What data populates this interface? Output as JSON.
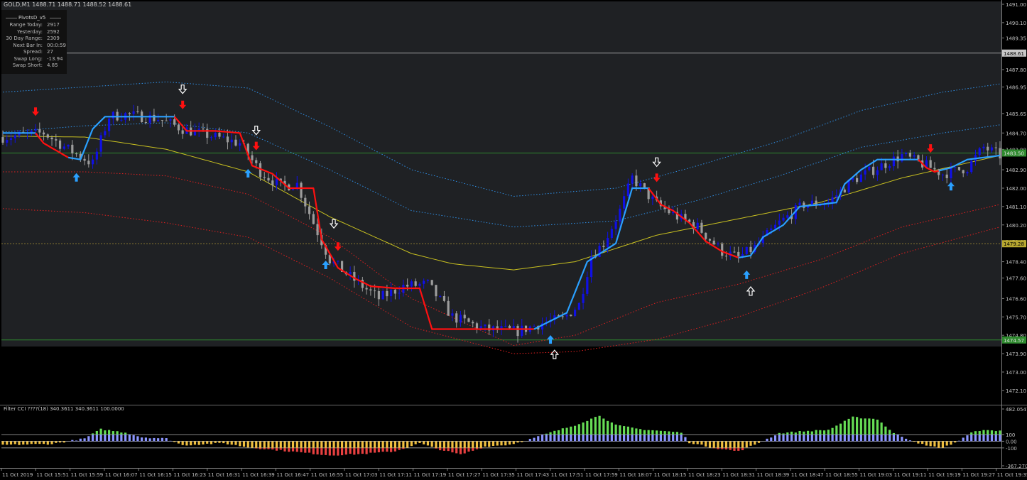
{
  "symbol": {
    "header": "GOLD,M1",
    "ohlc": "1488.71 1488.71 1488.52 1488.61"
  },
  "info_panel": {
    "title": "PivotsD_v5",
    "rows": [
      {
        "label": "Range  Today:",
        "value": "2917"
      },
      {
        "label": "Yesterday:",
        "value": "2592"
      },
      {
        "label": "30 Day Range:",
        "value": "2309"
      },
      {
        "label": "Next Bar In:",
        "value": "00:0:59"
      },
      {
        "label": "Spread:",
        "value": "27"
      },
      {
        "label": "Swap  Long:",
        "value": "-13.94"
      },
      {
        "label": "Swap  Short:",
        "value": "4.85"
      }
    ]
  },
  "indicator_label": "Filter CCI ????(18)  340.3611 340.3611 100.0000",
  "colors": {
    "background": "#000000",
    "price_area": "#1f2124",
    "bull_candle": "#1010e6",
    "bear_candle": "#9c9c9c",
    "trail_bull": "#2aa0ff",
    "trail_bear": "#ff1010",
    "ma": "#c8c020",
    "band_blue": "#2f8fe6",
    "band_red": "#e02020",
    "hist_green": "#66dd55",
    "hist_blue": "#8c96ff",
    "hist_yellow": "#f0c040",
    "hist_red": "#e84040",
    "level_green": "#2e8a2e",
    "axis_text": "#c0c0c0"
  },
  "chart_data": [
    {
      "type": "candlestick",
      "title": "GOLD,M1",
      "ylim": [
        1471.4,
        1491.0
      ],
      "y_ticks": [
        "1491.00",
        "1490.10",
        "1489.35",
        "1487.80",
        "1486.95",
        "1485.65",
        "1484.70",
        "1483.90",
        "1482.90",
        "1482.00",
        "1481.10",
        "1480.20",
        "1479.40",
        "1478.40",
        "1477.60",
        "1476.60",
        "1475.70",
        "1474.80",
        "1473.90",
        "1473.00",
        "1472.10"
      ],
      "price_labels": [
        {
          "text": "1488.61",
          "value": 1488.61,
          "kind": "bid"
        },
        {
          "text": "1483.50",
          "value": 1483.72,
          "kind": "green"
        },
        {
          "text": "1479.28",
          "value": 1479.28,
          "kind": "pivot"
        },
        {
          "text": "1474.57",
          "value": 1474.57,
          "kind": "green"
        }
      ],
      "x_labels": [
        "11 Oct 2019",
        "11 Oct 15:51",
        "11 Oct 15:59",
        "11 Oct 16:07",
        "11 Oct 16:15",
        "11 Oct 16:23",
        "11 Oct 16:31",
        "11 Oct 16:39",
        "11 Oct 16:47",
        "11 Oct 16:55",
        "11 Oct 17:03",
        "11 Oct 17:11",
        "11 Oct 17:19",
        "11 Oct 17:27",
        "11 Oct 17:35",
        "11 Oct 17:43",
        "11 Oct 17:51",
        "11 Oct 17:59",
        "11 Oct 18:07",
        "11 Oct 18:15",
        "11 Oct 18:23",
        "11 Oct 18:31",
        "11 Oct 18:39",
        "11 Oct 18:47",
        "11 Oct 18:55",
        "11 Oct 19:03",
        "11 Oct 19:11",
        "11 Oct 19:19",
        "11 Oct 19:27",
        "11 Oct 19:35"
      ],
      "close_path": [
        [
          0,
          1484.5
        ],
        [
          10,
          1484.7
        ],
        [
          16,
          1483.9
        ],
        [
          22,
          1483.2
        ],
        [
          26,
          1485.5
        ],
        [
          30,
          1485.6
        ],
        [
          38,
          1485.4
        ],
        [
          44,
          1484.9
        ],
        [
          50,
          1484.6
        ],
        [
          58,
          1484.2
        ],
        [
          63,
          1482.8
        ],
        [
          68,
          1482.1
        ],
        [
          72,
          1482.2
        ],
        [
          76,
          1480.3
        ],
        [
          80,
          1478.5
        ],
        [
          86,
          1477.5
        ],
        [
          92,
          1476.6
        ],
        [
          98,
          1477.2
        ],
        [
          104,
          1477.3
        ],
        [
          110,
          1475.7
        ],
        [
          118,
          1475.1
        ],
        [
          126,
          1475.0
        ],
        [
          132,
          1475.4
        ],
        [
          137,
          1475.6
        ],
        [
          141,
          1476.3
        ],
        [
          144,
          1478.7
        ],
        [
          147,
          1479.3
        ],
        [
          151,
          1480.9
        ],
        [
          154,
          1482.5
        ],
        [
          160,
          1481.2
        ],
        [
          165,
          1480.6
        ],
        [
          170,
          1480.1
        ],
        [
          176,
          1478.9
        ],
        [
          180,
          1478.6
        ],
        [
          184,
          1479.1
        ],
        [
          190,
          1480.3
        ],
        [
          196,
          1481.2
        ],
        [
          202,
          1481.3
        ],
        [
          208,
          1482.4
        ],
        [
          214,
          1483.0
        ],
        [
          220,
          1483.6
        ],
        [
          226,
          1483.1
        ],
        [
          230,
          1482.7
        ],
        [
          236,
          1483.0
        ],
        [
          240,
          1484.0
        ],
        [
          244,
          1483.6
        ]
      ],
      "trail_path": [
        [
          0,
          1484.7
        ],
        [
          8,
          1484.7
        ],
        [
          10,
          1484.2
        ],
        [
          16,
          1483.5
        ],
        [
          19,
          1483.4
        ],
        [
          22,
          1484.9
        ],
        [
          25,
          1485.5
        ],
        [
          34,
          1485.5
        ],
        [
          42,
          1485.5
        ],
        [
          45,
          1484.8
        ],
        [
          52,
          1484.8
        ],
        [
          58,
          1484.7
        ],
        [
          61,
          1483.1
        ],
        [
          66,
          1482.7
        ],
        [
          70,
          1482.0
        ],
        [
          76,
          1482.0
        ],
        [
          78,
          1479.5
        ],
        [
          82,
          1478.1
        ],
        [
          86,
          1477.6
        ],
        [
          90,
          1477.2
        ],
        [
          96,
          1477.1
        ],
        [
          102,
          1477.1
        ],
        [
          105,
          1475.1
        ],
        [
          112,
          1475.1
        ],
        [
          120,
          1475.1
        ],
        [
          128,
          1475.1
        ],
        [
          130,
          1475.1
        ],
        [
          134,
          1475.5
        ],
        [
          138,
          1475.9
        ],
        [
          140,
          1476.9
        ],
        [
          143,
          1478.4
        ],
        [
          150,
          1479.3
        ],
        [
          154,
          1482.0
        ],
        [
          158,
          1482.0
        ],
        [
          161,
          1481.2
        ],
        [
          164,
          1480.9
        ],
        [
          168,
          1480.3
        ],
        [
          172,
          1479.4
        ],
        [
          176,
          1478.9
        ],
        [
          180,
          1478.6
        ],
        [
          183,
          1478.7
        ],
        [
          186,
          1479.6
        ],
        [
          191,
          1480.2
        ],
        [
          195,
          1481.1
        ],
        [
          200,
          1481.2
        ],
        [
          204,
          1481.3
        ],
        [
          206,
          1482.2
        ],
        [
          210,
          1482.9
        ],
        [
          214,
          1483.4
        ],
        [
          220,
          1483.4
        ],
        [
          224,
          1483.4
        ],
        [
          226,
          1483.0
        ],
        [
          228,
          1482.8
        ],
        [
          232,
          1483.0
        ],
        [
          236,
          1483.4
        ],
        [
          244,
          1483.6
        ]
      ],
      "trail_color_segments": [
        {
          "from": 0,
          "to": 8,
          "trend": "bull"
        },
        {
          "from": 8,
          "to": 16,
          "trend": "bear"
        },
        {
          "from": 16,
          "to": 42,
          "trend": "bull"
        },
        {
          "from": 42,
          "to": 130,
          "trend": "bear"
        },
        {
          "from": 130,
          "to": 158,
          "trend": "bull"
        },
        {
          "from": 158,
          "to": 180,
          "trend": "bear"
        },
        {
          "from": 180,
          "to": 224,
          "trend": "bull"
        },
        {
          "from": 224,
          "to": 229,
          "trend": "bear"
        },
        {
          "from": 229,
          "to": 244,
          "trend": "bull"
        }
      ],
      "ma_path": [
        [
          0,
          1484.55
        ],
        [
          20,
          1484.5
        ],
        [
          40,
          1483.9
        ],
        [
          60,
          1482.8
        ],
        [
          80,
          1480.6
        ],
        [
          100,
          1478.8
        ],
        [
          110,
          1478.3
        ],
        [
          125,
          1478.0
        ],
        [
          140,
          1478.4
        ],
        [
          160,
          1479.7
        ],
        [
          180,
          1480.5
        ],
        [
          200,
          1481.3
        ],
        [
          220,
          1482.5
        ],
        [
          244,
          1483.6
        ]
      ],
      "band_blue_upper": [
        [
          0,
          1486.7
        ],
        [
          20,
          1486.95
        ],
        [
          40,
          1487.2
        ],
        [
          60,
          1486.9
        ],
        [
          80,
          1485.0
        ],
        [
          100,
          1482.9
        ],
        [
          125,
          1481.6
        ],
        [
          150,
          1482.0
        ],
        [
          170,
          1483.1
        ],
        [
          190,
          1484.3
        ],
        [
          210,
          1485.8
        ],
        [
          230,
          1486.7
        ],
        [
          244,
          1487.1
        ]
      ],
      "band_blue_lower": [
        [
          0,
          1484.75
        ],
        [
          20,
          1485.05
        ],
        [
          40,
          1485.2
        ],
        [
          60,
          1484.7
        ],
        [
          80,
          1482.9
        ],
        [
          100,
          1480.9
        ],
        [
          125,
          1480.1
        ],
        [
          150,
          1480.4
        ],
        [
          170,
          1481.4
        ],
        [
          190,
          1482.6
        ],
        [
          210,
          1484.0
        ],
        [
          230,
          1484.7
        ],
        [
          244,
          1485.1
        ]
      ],
      "band_red_upper": [
        [
          0,
          1482.8
        ],
        [
          20,
          1482.8
        ],
        [
          40,
          1482.6
        ],
        [
          60,
          1481.7
        ],
        [
          80,
          1479.6
        ],
        [
          100,
          1476.6
        ],
        [
          125,
          1474.3
        ],
        [
          140,
          1474.8
        ],
        [
          160,
          1476.4
        ],
        [
          180,
          1477.3
        ],
        [
          200,
          1478.5
        ],
        [
          220,
          1480.1
        ],
        [
          244,
          1481.2
        ]
      ],
      "band_red_lower": [
        [
          0,
          1481.0
        ],
        [
          20,
          1480.8
        ],
        [
          40,
          1480.3
        ],
        [
          60,
          1479.6
        ],
        [
          80,
          1477.6
        ],
        [
          100,
          1475.2
        ],
        [
          125,
          1473.9
        ],
        [
          140,
          1474.0
        ],
        [
          160,
          1474.6
        ],
        [
          180,
          1475.7
        ],
        [
          200,
          1477.1
        ],
        [
          220,
          1478.8
        ],
        [
          244,
          1480.1
        ]
      ],
      "arrows": [
        {
          "x": 8,
          "type": "down-red"
        },
        {
          "x": 18,
          "type": "up-blue"
        },
        {
          "x": 44,
          "type": "down-red"
        },
        {
          "x": 44,
          "type": "down-white"
        },
        {
          "x": 60,
          "type": "up-blue"
        },
        {
          "x": 62,
          "type": "down-red"
        },
        {
          "x": 62,
          "type": "down-white"
        },
        {
          "x": 79,
          "type": "up-blue"
        },
        {
          "x": 82,
          "type": "down-red"
        },
        {
          "x": 81,
          "type": "down-white"
        },
        {
          "x": 134,
          "type": "up-blue"
        },
        {
          "x": 135,
          "type": "up-white"
        },
        {
          "x": 160,
          "type": "down-red"
        },
        {
          "x": 160,
          "type": "down-white"
        },
        {
          "x": 182,
          "type": "up-blue"
        },
        {
          "x": 183,
          "type": "up-white"
        },
        {
          "x": 227,
          "type": "down-red"
        },
        {
          "x": 232,
          "type": "up-blue"
        }
      ]
    },
    {
      "type": "histogram",
      "title": "Filter CCI ????(18)",
      "ylim": [
        -367.2703,
        482.0547
      ],
      "y_ticks": [
        "482.0547",
        "100",
        "0.00",
        "-100",
        "-367.2703"
      ],
      "levels": [
        100,
        0,
        -100
      ],
      "cci_path": [
        [
          0,
          -55
        ],
        [
          12,
          -40
        ],
        [
          20,
          40
        ],
        [
          24,
          180
        ],
        [
          30,
          130
        ],
        [
          34,
          60
        ],
        [
          40,
          40
        ],
        [
          44,
          -60
        ],
        [
          50,
          -40
        ],
        [
          54,
          -30
        ],
        [
          60,
          -90
        ],
        [
          70,
          -150
        ],
        [
          80,
          -210
        ],
        [
          88,
          -190
        ],
        [
          96,
          -150
        ],
        [
          102,
          -30
        ],
        [
          106,
          -110
        ],
        [
          112,
          -200
        ],
        [
          118,
          -80
        ],
        [
          124,
          -50
        ],
        [
          128,
          10
        ],
        [
          134,
          130
        ],
        [
          140,
          240
        ],
        [
          146,
          385
        ],
        [
          150,
          240
        ],
        [
          156,
          180
        ],
        [
          162,
          150
        ],
        [
          166,
          130
        ],
        [
          168,
          -20
        ],
        [
          174,
          -100
        ],
        [
          180,
          -150
        ],
        [
          184,
          -50
        ],
        [
          190,
          120
        ],
        [
          196,
          150
        ],
        [
          202,
          170
        ],
        [
          208,
          360
        ],
        [
          214,
          330
        ],
        [
          218,
          120
        ],
        [
          222,
          20
        ],
        [
          226,
          -70
        ],
        [
          230,
          -100
        ],
        [
          234,
          10
        ],
        [
          238,
          160
        ],
        [
          244,
          160
        ]
      ]
    }
  ]
}
